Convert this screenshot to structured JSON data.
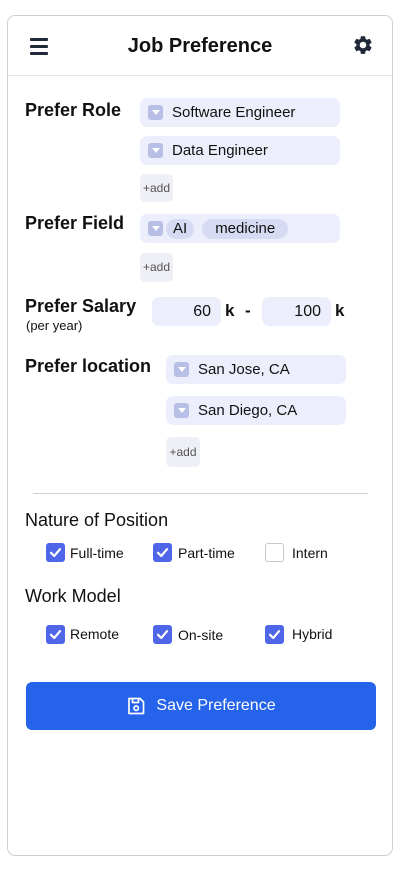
{
  "header": {
    "title": "Job Preference"
  },
  "role": {
    "label": "Prefer Role",
    "items": [
      "Software Engineer",
      "Data Engineer"
    ],
    "add_label": "+add"
  },
  "field": {
    "label": "Prefer Field",
    "tags": [
      "AI",
      "medicine"
    ],
    "add_label": "+add"
  },
  "salary": {
    "label": "Prefer Salary",
    "sublabel": "(per year)",
    "min": "60",
    "max": "100",
    "unit": "k",
    "separator": "-"
  },
  "location": {
    "label": "Prefer location",
    "items": [
      "San Jose, CA",
      "San Diego, CA"
    ],
    "add_label": "+add"
  },
  "nature": {
    "title": "Nature of Position",
    "options": [
      {
        "label": "Full-time",
        "checked": true
      },
      {
        "label": "Part-time",
        "checked": true
      },
      {
        "label": "Intern",
        "checked": false
      }
    ]
  },
  "work_model": {
    "title": "Work Model",
    "options": [
      {
        "label": "Remote",
        "checked": true
      },
      {
        "label": "On-site",
        "checked": true
      },
      {
        "label": "Hybrid",
        "checked": true
      }
    ]
  },
  "save_label": "Save Preference",
  "colors": {
    "accent": "#2563eb",
    "checkbox": "#4f66e8",
    "chip": "#eceffb"
  },
  "icons": {
    "menu": "menu-icon",
    "settings": "gear-icon",
    "save": "save-icon",
    "dropdown": "chevron-down-icon"
  }
}
